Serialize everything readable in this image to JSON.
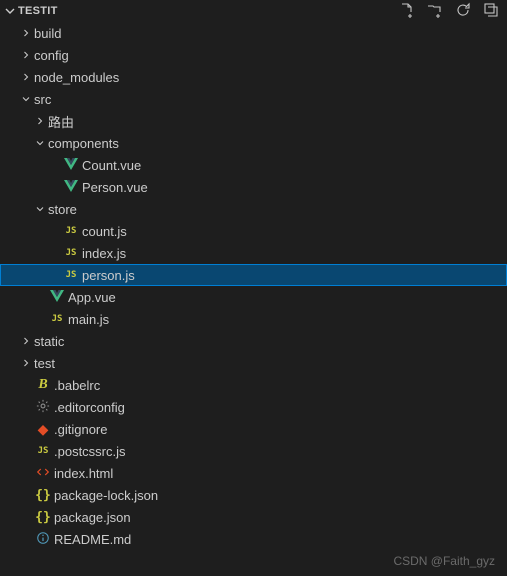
{
  "header": {
    "title": "TESTIT"
  },
  "watermark": "CSDN @Faith_gyz",
  "icons": {
    "vue": "vue",
    "js": "js",
    "babel": "babel",
    "gear": "gear",
    "git": "git",
    "html": "html",
    "json": "json",
    "info": "info"
  },
  "tree": [
    {
      "label": "build",
      "type": "folder",
      "expanded": false,
      "depth": 1
    },
    {
      "label": "config",
      "type": "folder",
      "expanded": false,
      "depth": 1
    },
    {
      "label": "node_modules",
      "type": "folder",
      "expanded": false,
      "depth": 1
    },
    {
      "label": "src",
      "type": "folder",
      "expanded": true,
      "depth": 1
    },
    {
      "label": "路由",
      "type": "folder",
      "expanded": false,
      "depth": 2
    },
    {
      "label": "components",
      "type": "folder",
      "expanded": true,
      "depth": 2
    },
    {
      "label": "Count.vue",
      "type": "file",
      "icon": "vue",
      "depth": 3
    },
    {
      "label": "Person.vue",
      "type": "file",
      "icon": "vue",
      "depth": 3
    },
    {
      "label": "store",
      "type": "folder",
      "expanded": true,
      "depth": 2
    },
    {
      "label": "count.js",
      "type": "file",
      "icon": "js",
      "depth": 3
    },
    {
      "label": "index.js",
      "type": "file",
      "icon": "js",
      "depth": 3
    },
    {
      "label": "person.js",
      "type": "file",
      "icon": "js",
      "depth": 3,
      "selected": true
    },
    {
      "label": "App.vue",
      "type": "file",
      "icon": "vue",
      "depth": 2
    },
    {
      "label": "main.js",
      "type": "file",
      "icon": "js",
      "depth": 2
    },
    {
      "label": "static",
      "type": "folder",
      "expanded": false,
      "depth": 1
    },
    {
      "label": "test",
      "type": "folder",
      "expanded": false,
      "depth": 1
    },
    {
      "label": ".babelrc",
      "type": "file",
      "icon": "babel",
      "depth": 1
    },
    {
      "label": ".editorconfig",
      "type": "file",
      "icon": "gear",
      "depth": 1
    },
    {
      "label": ".gitignore",
      "type": "file",
      "icon": "git",
      "depth": 1
    },
    {
      "label": ".postcssrc.js",
      "type": "file",
      "icon": "js",
      "depth": 1
    },
    {
      "label": "index.html",
      "type": "file",
      "icon": "html",
      "depth": 1
    },
    {
      "label": "package-lock.json",
      "type": "file",
      "icon": "json",
      "depth": 1
    },
    {
      "label": "package.json",
      "type": "file",
      "icon": "json",
      "depth": 1
    },
    {
      "label": "README.md",
      "type": "file",
      "icon": "info",
      "depth": 1
    }
  ]
}
